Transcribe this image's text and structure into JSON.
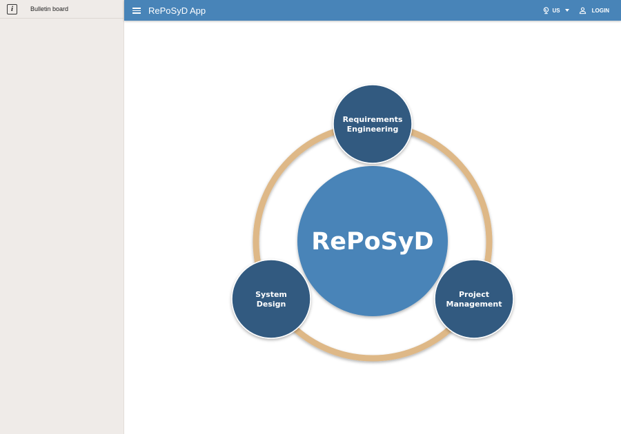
{
  "sidebar": {
    "items": [
      {
        "label": "Bulletin board",
        "icon": "info-icon"
      }
    ]
  },
  "header": {
    "title": "RePoSyD App",
    "language": "US",
    "login_label": "LOGIN",
    "background_color": "#4884b8"
  },
  "diagram": {
    "center": "RePoSyD",
    "nodes": [
      {
        "line1": "Requirements",
        "line2": "Engineering"
      },
      {
        "line1": "System",
        "line2": "Design"
      },
      {
        "line1": "Project",
        "line2": "Management"
      }
    ],
    "colors": {
      "center": "#4884b8",
      "node": "#305a80",
      "ring": "#deb887"
    }
  }
}
